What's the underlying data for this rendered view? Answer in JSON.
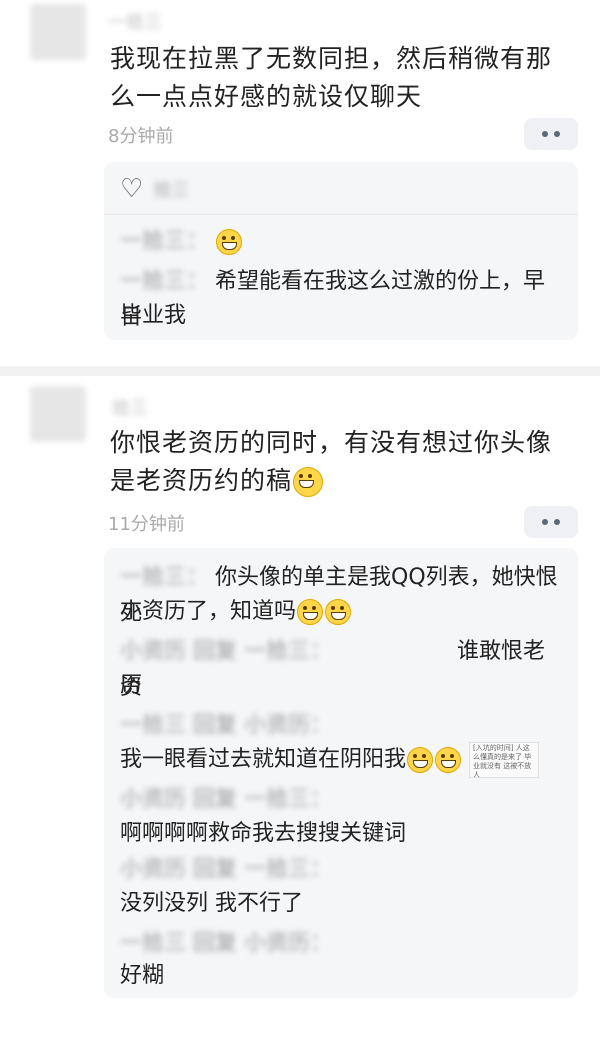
{
  "post1": {
    "username": "一拾三",
    "text_line1": "我现在拉黑了无数同担，然后稍微有那",
    "text_line2": "么一点点好感的就设仅聊天",
    "time": "8分钟前",
    "replies": {
      "like_names": "拾三",
      "r1_name": "一拾三：",
      "r2_name": "一拾三：",
      "r2_text_a": "希望能看在我这么过激的份上，早日",
      "r2_text_b": "毕业我"
    }
  },
  "post2": {
    "username": "拾三",
    "text_line1": "你恨老资历的同时，有没有想过你头像",
    "text_line2": "是老资历约的稿",
    "time": "11分钟前",
    "replies": {
      "r1_name": "一拾三：",
      "r1_text_a": "你头像的单主是我QQ列表，她快恨死",
      "r1_text_b": "小资历了，知道吗",
      "r2_name": "小资历 回复 一拾三：",
      "r2_text_a": "谁敢恨老资",
      "r2_text_b": "历",
      "r3_name": "一拾三 回复 小资历：",
      "r3_text": "我一眼看过去就知道在阴阳我",
      "sticker_text": "[入坑的时间] 人这么懂真的是来了 毕业就没有 这被不放人",
      "r4_name": "小资历 回复 一拾三：",
      "r4_text": "啊啊啊啊救命我去搜搜关键词",
      "r5_name": "小资历 回复 一拾三：",
      "r5_text": "没列没列 我不行了",
      "r6_name": "一拾三 回复 小资历：",
      "r6_text": "好糊"
    }
  }
}
